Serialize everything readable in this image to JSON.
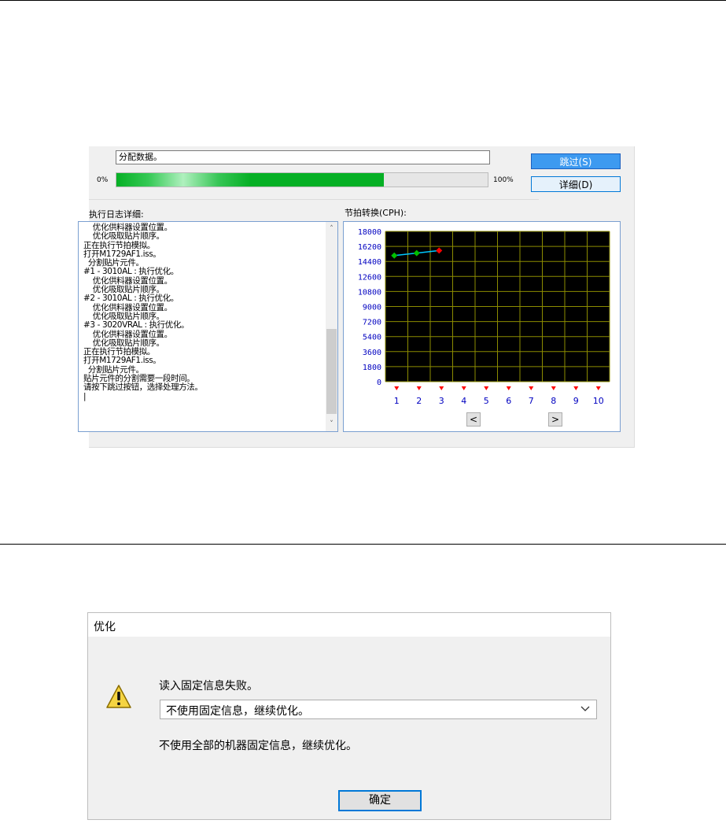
{
  "progress_window": {
    "status_text": "分配数据。",
    "progress": {
      "min_label": "0%",
      "max_label": "100%",
      "value_percent": 72
    },
    "buttons": {
      "skip_label": "跳过(S)",
      "detail_label": "详细(D)"
    },
    "log": {
      "label": "执行日志详细:",
      "lines": [
        "    优化供料器设置位置。",
        "    优化吸取贴片顺序。",
        "正在执行节拍模拟。",
        "打开M1729AF1.iss。",
        "  分割贴片元件。",
        "#1 - 3010AL : 执行优化。",
        "    优化供料器设置位置。",
        "    优化吸取贴片顺序。",
        "#2 - 3010AL : 执行优化。",
        "    优化供料器设置位置。",
        "    优化吸取贴片顺序。",
        "#3 - 3020VRAL : 执行优化。",
        "    优化供料器设置位置。",
        "    优化吸取贴片顺序。",
        "正在执行节拍模拟。",
        "打开M1729AF1.iss。",
        "  分割贴片元件。",
        "贴片元件的分割需要一段时间。",
        "请按下跳过按钮，选择处理方法。",
        "|"
      ],
      "scroll_up": "˄",
      "scroll_down": "˅"
    },
    "tact": {
      "label": "节拍转换(CPH):",
      "prev": "<",
      "next": ">"
    }
  },
  "chart_data": {
    "type": "line",
    "title": "节拍转换(CPH):",
    "x": [
      1,
      2,
      3
    ],
    "categories": [
      "1",
      "2",
      "3",
      "4",
      "5",
      "6",
      "7",
      "8",
      "9",
      "10"
    ],
    "values": [
      15100,
      15400,
      15700
    ],
    "point_colors": [
      "#00c000",
      "#00c000",
      "#ff0000"
    ],
    "yticks": [
      0,
      1800,
      3600,
      5400,
      7200,
      9000,
      10800,
      12600,
      14400,
      16200,
      18000
    ],
    "ylim": [
      0,
      18000
    ],
    "grid": true,
    "background": "#000000",
    "grid_color": "#8c8c00",
    "line_color": "#00c8ff",
    "tick_label_color": "#0000c0",
    "marker_color": "#ff0000"
  },
  "dialog": {
    "title": "优化",
    "icon": "warning-icon",
    "message": "读入固定信息失败。",
    "selected_option": "不使用固定信息，继续优化。",
    "description": "不使用全部的机器固定信息，继续优化。",
    "ok_label": "确定"
  }
}
